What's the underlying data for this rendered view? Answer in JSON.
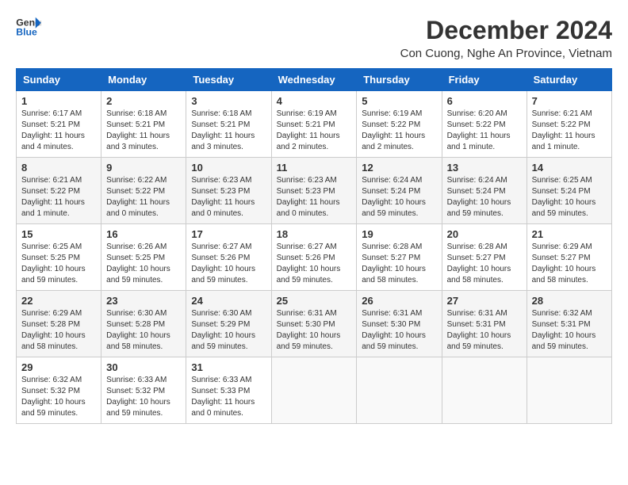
{
  "header": {
    "logo_line1": "General",
    "logo_line2": "Blue",
    "month_title": "December 2024",
    "location": "Con Cuong, Nghe An Province, Vietnam"
  },
  "weekdays": [
    "Sunday",
    "Monday",
    "Tuesday",
    "Wednesday",
    "Thursday",
    "Friday",
    "Saturday"
  ],
  "weeks": [
    [
      {
        "day": "1",
        "info": "Sunrise: 6:17 AM\nSunset: 5:21 PM\nDaylight: 11 hours\nand 4 minutes."
      },
      {
        "day": "2",
        "info": "Sunrise: 6:18 AM\nSunset: 5:21 PM\nDaylight: 11 hours\nand 3 minutes."
      },
      {
        "day": "3",
        "info": "Sunrise: 6:18 AM\nSunset: 5:21 PM\nDaylight: 11 hours\nand 3 minutes."
      },
      {
        "day": "4",
        "info": "Sunrise: 6:19 AM\nSunset: 5:21 PM\nDaylight: 11 hours\nand 2 minutes."
      },
      {
        "day": "5",
        "info": "Sunrise: 6:19 AM\nSunset: 5:22 PM\nDaylight: 11 hours\nand 2 minutes."
      },
      {
        "day": "6",
        "info": "Sunrise: 6:20 AM\nSunset: 5:22 PM\nDaylight: 11 hours\nand 1 minute."
      },
      {
        "day": "7",
        "info": "Sunrise: 6:21 AM\nSunset: 5:22 PM\nDaylight: 11 hours\nand 1 minute."
      }
    ],
    [
      {
        "day": "8",
        "info": "Sunrise: 6:21 AM\nSunset: 5:22 PM\nDaylight: 11 hours\nand 1 minute."
      },
      {
        "day": "9",
        "info": "Sunrise: 6:22 AM\nSunset: 5:22 PM\nDaylight: 11 hours\nand 0 minutes."
      },
      {
        "day": "10",
        "info": "Sunrise: 6:23 AM\nSunset: 5:23 PM\nDaylight: 11 hours\nand 0 minutes."
      },
      {
        "day": "11",
        "info": "Sunrise: 6:23 AM\nSunset: 5:23 PM\nDaylight: 11 hours\nand 0 minutes."
      },
      {
        "day": "12",
        "info": "Sunrise: 6:24 AM\nSunset: 5:24 PM\nDaylight: 10 hours\nand 59 minutes."
      },
      {
        "day": "13",
        "info": "Sunrise: 6:24 AM\nSunset: 5:24 PM\nDaylight: 10 hours\nand 59 minutes."
      },
      {
        "day": "14",
        "info": "Sunrise: 6:25 AM\nSunset: 5:24 PM\nDaylight: 10 hours\nand 59 minutes."
      }
    ],
    [
      {
        "day": "15",
        "info": "Sunrise: 6:25 AM\nSunset: 5:25 PM\nDaylight: 10 hours\nand 59 minutes."
      },
      {
        "day": "16",
        "info": "Sunrise: 6:26 AM\nSunset: 5:25 PM\nDaylight: 10 hours\nand 59 minutes."
      },
      {
        "day": "17",
        "info": "Sunrise: 6:27 AM\nSunset: 5:26 PM\nDaylight: 10 hours\nand 59 minutes."
      },
      {
        "day": "18",
        "info": "Sunrise: 6:27 AM\nSunset: 5:26 PM\nDaylight: 10 hours\nand 59 minutes."
      },
      {
        "day": "19",
        "info": "Sunrise: 6:28 AM\nSunset: 5:27 PM\nDaylight: 10 hours\nand 58 minutes."
      },
      {
        "day": "20",
        "info": "Sunrise: 6:28 AM\nSunset: 5:27 PM\nDaylight: 10 hours\nand 58 minutes."
      },
      {
        "day": "21",
        "info": "Sunrise: 6:29 AM\nSunset: 5:27 PM\nDaylight: 10 hours\nand 58 minutes."
      }
    ],
    [
      {
        "day": "22",
        "info": "Sunrise: 6:29 AM\nSunset: 5:28 PM\nDaylight: 10 hours\nand 58 minutes."
      },
      {
        "day": "23",
        "info": "Sunrise: 6:30 AM\nSunset: 5:28 PM\nDaylight: 10 hours\nand 58 minutes."
      },
      {
        "day": "24",
        "info": "Sunrise: 6:30 AM\nSunset: 5:29 PM\nDaylight: 10 hours\nand 59 minutes."
      },
      {
        "day": "25",
        "info": "Sunrise: 6:31 AM\nSunset: 5:30 PM\nDaylight: 10 hours\nand 59 minutes."
      },
      {
        "day": "26",
        "info": "Sunrise: 6:31 AM\nSunset: 5:30 PM\nDaylight: 10 hours\nand 59 minutes."
      },
      {
        "day": "27",
        "info": "Sunrise: 6:31 AM\nSunset: 5:31 PM\nDaylight: 10 hours\nand 59 minutes."
      },
      {
        "day": "28",
        "info": "Sunrise: 6:32 AM\nSunset: 5:31 PM\nDaylight: 10 hours\nand 59 minutes."
      }
    ],
    [
      {
        "day": "29",
        "info": "Sunrise: 6:32 AM\nSunset: 5:32 PM\nDaylight: 10 hours\nand 59 minutes."
      },
      {
        "day": "30",
        "info": "Sunrise: 6:33 AM\nSunset: 5:32 PM\nDaylight: 10 hours\nand 59 minutes."
      },
      {
        "day": "31",
        "info": "Sunrise: 6:33 AM\nSunset: 5:33 PM\nDaylight: 11 hours\nand 0 minutes."
      },
      {
        "day": "",
        "info": ""
      },
      {
        "day": "",
        "info": ""
      },
      {
        "day": "",
        "info": ""
      },
      {
        "day": "",
        "info": ""
      }
    ]
  ]
}
